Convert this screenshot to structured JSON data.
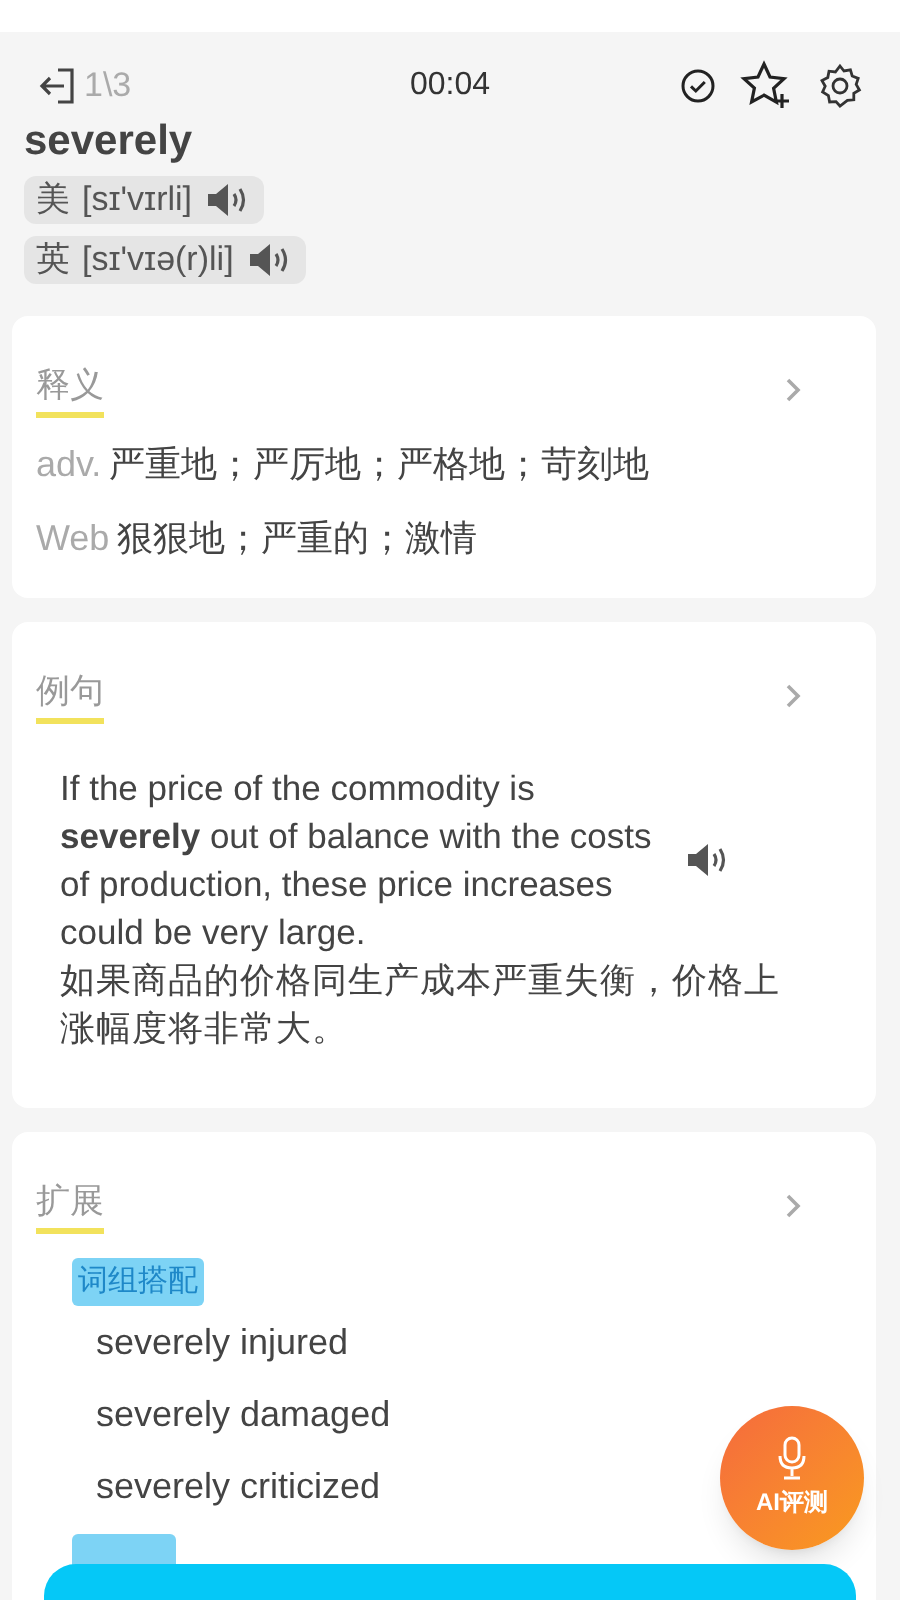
{
  "header": {
    "counter": "1\\3",
    "timer": "00:04"
  },
  "word": "severely",
  "pronunciations": [
    {
      "region": "美",
      "ipa": "[sɪ'vɪrli]"
    },
    {
      "region": "英",
      "ipa": "[sɪ'vɪə(r)li]"
    }
  ],
  "definition": {
    "title": "释义",
    "entries": [
      {
        "pos": "adv.",
        "meaning": "严重地；严厉地；严格地；苛刻地"
      },
      {
        "pos": "Web",
        "meaning": "狠狠地；严重的；激情"
      }
    ]
  },
  "example": {
    "title": "例句",
    "sentence": "If the price of the commodity is **severely** out of balance with the costs of production, these price increases could be very large.",
    "translation": "如果商品的价格同生产成本严重失衡，价格上涨幅度将非常大。"
  },
  "extension": {
    "title": "扩展",
    "groups": [
      {
        "tag": "词组搭配",
        "phrases": [
          "severely injured",
          "severely damaged",
          "severely criticized"
        ]
      }
    ]
  },
  "ai_button": {
    "label": "AI评测"
  }
}
